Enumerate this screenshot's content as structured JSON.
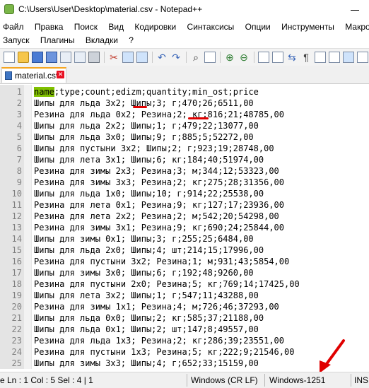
{
  "window": {
    "title": "C:\\Users\\User\\Desktop\\material.csv - Notepad++"
  },
  "menu": {
    "row1": [
      "Файл",
      "Правка",
      "Поиск",
      "Вид",
      "Кодировки",
      "Синтаксисы",
      "Опции",
      "Инструменты",
      "Макросы"
    ],
    "row2": [
      "Запуск",
      "Плагины",
      "Вкладки",
      "?"
    ]
  },
  "toolbar": {
    "icons": [
      "new-icon",
      "open-icon",
      "save-icon",
      "save-all-icon",
      "close-icon",
      "close-all-icon",
      "print-icon",
      "cut-icon",
      "copy-icon",
      "paste-icon",
      "undo-icon",
      "redo-icon",
      "find-icon",
      "replace-icon",
      "zoom-in-icon",
      "zoom-out-icon",
      "sync-icon",
      "wrap-icon",
      "pilcrow-icon",
      "indent-guide-icon"
    ]
  },
  "tab": {
    "label": "material.csv"
  },
  "editor": {
    "lines": [
      {
        "n": "1",
        "text": "name;type;count;edizm;quantity;min_ost;price",
        "hl": "name"
      },
      {
        "n": "2",
        "text": "Шипы для льда 3х2; Шипы;3; г;470;26;6511,00"
      },
      {
        "n": "3",
        "text": "Резина для льда 0х2; Резина;2; кг;816;21;48785,00"
      },
      {
        "n": "4",
        "text": "Шипы для льда 2х2; Шипы;1; г;479;22;13077,00"
      },
      {
        "n": "5",
        "text": "Шипы для льда 3х0; Шипы;9; г;885;5;52272,00"
      },
      {
        "n": "6",
        "text": "Шипы для пустыни 3х2; Шипы;2; г;923;19;28748,00"
      },
      {
        "n": "7",
        "text": "Шипы для лета 3х1; Шипы;6; кг;184;40;51974,00"
      },
      {
        "n": "8",
        "text": "Резина для зимы 2х3; Резина;3; м;344;12;53323,00"
      },
      {
        "n": "9",
        "text": "Резина для зимы 3х3; Резина;2; кг;275;28;31356,00"
      },
      {
        "n": "10",
        "text": "Шипы для льда 1х0; Шипы;10; г;914;22;25538,00"
      },
      {
        "n": "11",
        "text": "Резина для лета 0х1; Резина;9; кг;127;17;23936,00"
      },
      {
        "n": "12",
        "text": "Резина для лета 2х2; Резина;2; м;542;20;54298,00"
      },
      {
        "n": "13",
        "text": "Резина для зимы 3х1; Резина;9; кг;690;24;25844,00"
      },
      {
        "n": "14",
        "text": "Шипы для зимы 0х1; Шипы;3; г;255;25;6484,00"
      },
      {
        "n": "15",
        "text": "Шипы для льда 2х0; Шипы;4; шт;214;15;17996,00"
      },
      {
        "n": "16",
        "text": "Резина для пустыни 3х2; Резина;1; м;931;43;5854,00"
      },
      {
        "n": "17",
        "text": "Шипы для зимы 3х0; Шипы;6; г;192;48;9260,00"
      },
      {
        "n": "18",
        "text": "Резина для пустыни 2х0; Резина;5; кг;769;14;17425,00"
      },
      {
        "n": "19",
        "text": "Шипы для лета 3х2; Шипы;1; г;547;11;43288,00"
      },
      {
        "n": "20",
        "text": "Резина для зимы 1х1; Резина;4; м;726;46;37293,00"
      },
      {
        "n": "21",
        "text": "Шипы для льда 0х0; Шипы;2; кг;585;37;21188,00"
      },
      {
        "n": "22",
        "text": "Шипы для льда 0х1; Шипы;2; шт;147;8;49557,00"
      },
      {
        "n": "23",
        "text": "Резина для льда 1х3; Резина;2; кг;286;39;23551,00"
      },
      {
        "n": "24",
        "text": "Резина для пустыни 1х3; Резина;5; кг;222;9;21546,00"
      },
      {
        "n": "25",
        "text": "Шипы для зимы 3х3; Шипы;4; г;652;33;15159,00"
      }
    ]
  },
  "statusbar": {
    "position": "e Ln : 1   Col : 5   Sel : 4 | 1",
    "eol": "Windows (CR LF)",
    "encoding": "Windows-1251",
    "mode": "INS"
  },
  "colors": {
    "highlight": "#80c000",
    "annotation": "#e00000",
    "tab_accent": "#f5a623"
  }
}
